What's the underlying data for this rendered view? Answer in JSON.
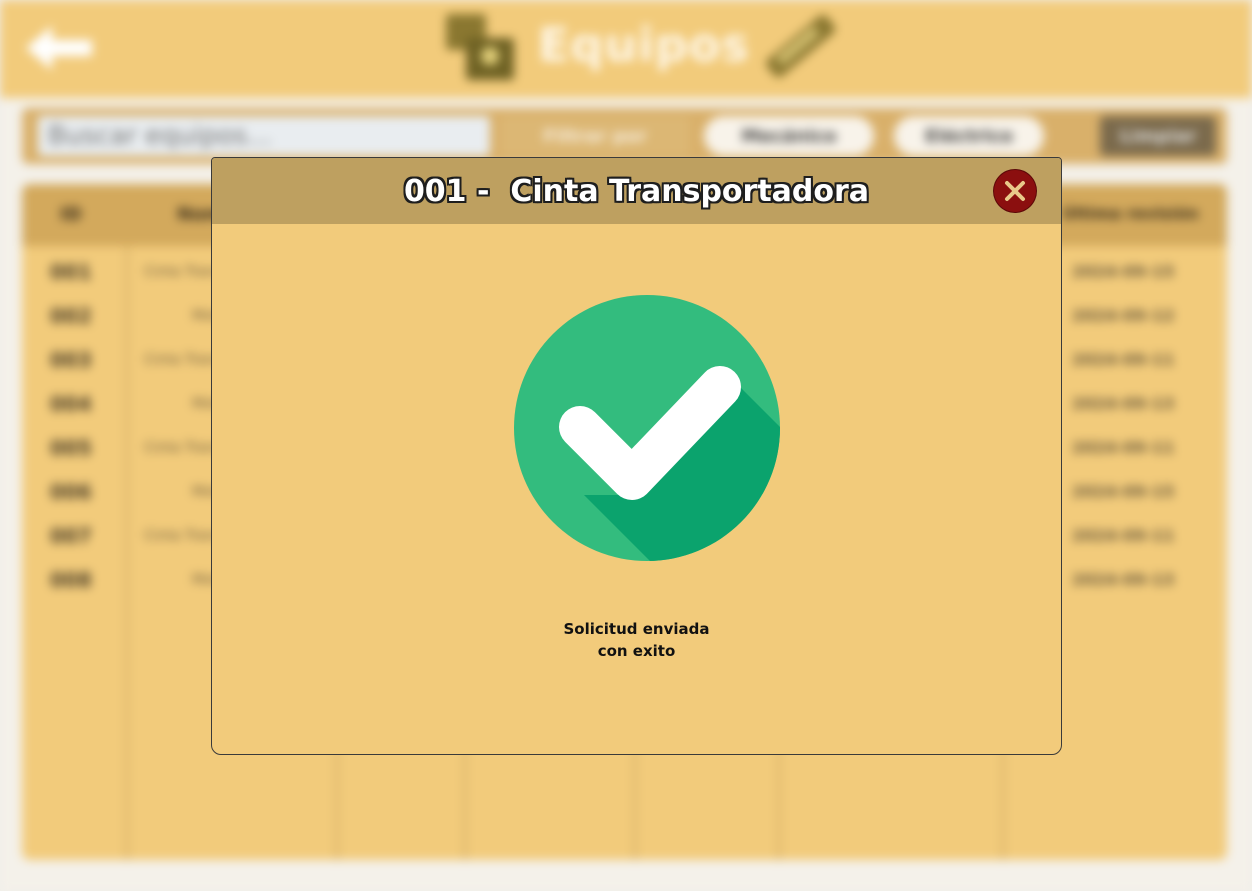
{
  "background": {
    "page_title": "Equipos",
    "search": {
      "placeholder": "Buscar equipos..."
    },
    "filters": {
      "label": "Filtrar por",
      "option_a": "Mecánico",
      "option_b": "Eléctrico",
      "option_c": "Limpiar"
    },
    "table": {
      "headers": {
        "id": "ID",
        "name": "Nombre",
        "date": "Última revisión"
      },
      "rows": [
        {
          "id": "001",
          "name": "Cinta Transportadora",
          "date": "2024-09-15"
        },
        {
          "id": "002",
          "name": "Motor",
          "date": "2024-09-12"
        },
        {
          "id": "003",
          "name": "Cinta Transportadora",
          "date": "2024-09-11"
        },
        {
          "id": "004",
          "name": "Motor",
          "date": "2024-09-13"
        },
        {
          "id": "005",
          "name": "Cinta Transportadora",
          "date": "2024-09-11"
        },
        {
          "id": "006",
          "name": "Motor",
          "date": "2024-09-15"
        },
        {
          "id": "007",
          "name": "Cinta Transportadora",
          "date": "2024-09-11"
        },
        {
          "id": "008",
          "name": "Motor",
          "date": "2024-09-13"
        }
      ]
    }
  },
  "modal": {
    "title": "001 -  Cinta Transportadora",
    "message_line1": "Solicitud enviada",
    "message_line2": "con exito",
    "icons": {
      "close": "close-icon",
      "success": "check-circle-icon"
    },
    "colors": {
      "header": "#bea060",
      "body": "#f2cb7b",
      "success": "#33bc7e",
      "success_shadow": "#0ba36d",
      "close": "#8b0f0f"
    }
  }
}
